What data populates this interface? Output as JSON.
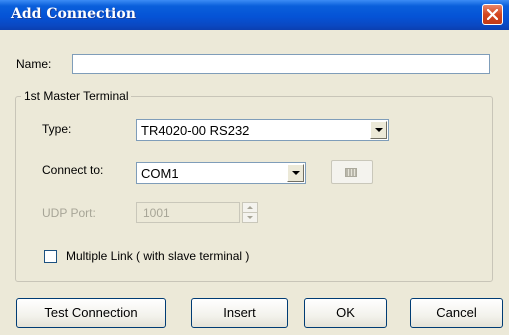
{
  "window": {
    "title": "Add Connection",
    "close_icon": "close-icon"
  },
  "name_field": {
    "label": "Name:",
    "value": ""
  },
  "group": {
    "title": "1st Master Terminal",
    "type": {
      "label": "Type:",
      "value": "TR4020-00 RS232"
    },
    "connect_to": {
      "label": "Connect to:",
      "value": "COM1",
      "button_icon": "port-settings-icon"
    },
    "udp_port": {
      "label": "UDP Port:",
      "value": "1001"
    },
    "multiple_link": {
      "label": "Multiple Link ( with slave terminal )",
      "checked": false
    }
  },
  "buttons": {
    "test_connection": "Test Connection",
    "insert": "Insert",
    "ok": "OK",
    "cancel": "Cancel"
  },
  "colors": {
    "title_bar": "#0553D6",
    "dialog_bg": "#ECE9D8",
    "close_button": "#D4461F"
  }
}
